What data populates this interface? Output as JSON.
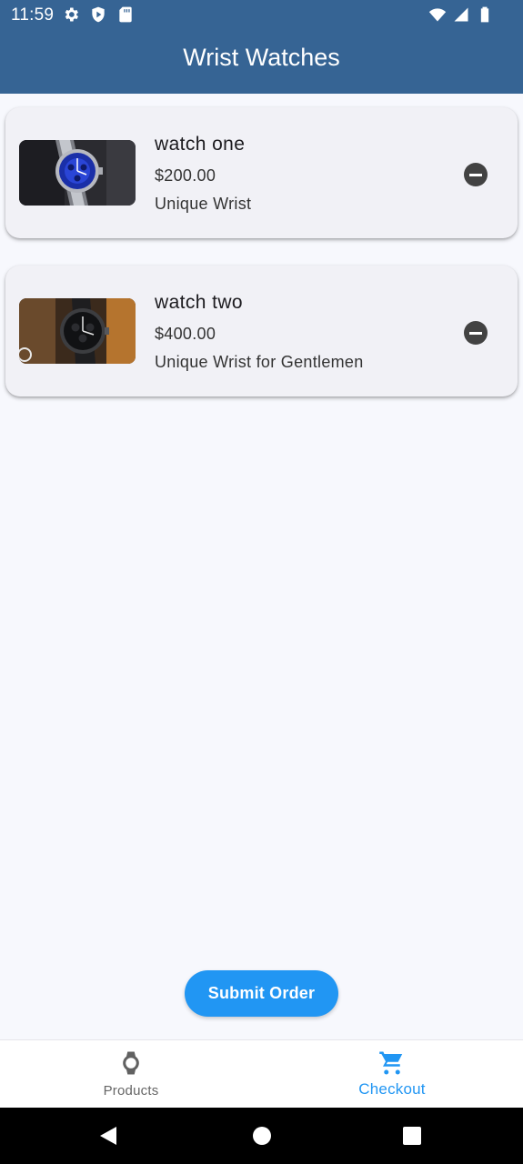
{
  "status_bar": {
    "time": "11:59",
    "icons_left": [
      "settings-icon",
      "shield-icon",
      "sd-card-icon"
    ],
    "icons_right": [
      "wifi-icon",
      "cellular-signal-icon",
      "battery-icon"
    ]
  },
  "app_bar": {
    "title": "Wrist Watches",
    "color": "#366494"
  },
  "cart_items": [
    {
      "name": "watch one",
      "price": "$200.00",
      "description": "Unique Wrist",
      "image": "blue-dial-watch-image"
    },
    {
      "name": "watch two",
      "price": "$400.00",
      "description": "Unique Wrist for Gentlemen",
      "image": "black-chronograph-watch-image"
    }
  ],
  "submit_button": {
    "label": "Submit Order",
    "color": "#2196f3"
  },
  "bottom_nav": {
    "items": [
      {
        "label": "Products",
        "icon": "watch-icon",
        "active": false
      },
      {
        "label": "Checkout",
        "icon": "shopping-cart-icon",
        "active": true
      }
    ],
    "active_color": "#2196f3"
  },
  "system_nav": {
    "icons": [
      "back-icon",
      "home-icon",
      "recents-icon"
    ]
  }
}
